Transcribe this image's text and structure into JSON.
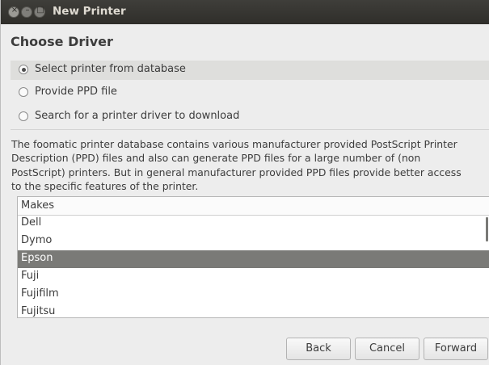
{
  "window": {
    "title": "New Printer",
    "controls": [
      "close-icon",
      "minimize-icon",
      "maximize-icon"
    ]
  },
  "page": {
    "heading": "Choose Driver"
  },
  "options": [
    {
      "label": "Select printer from database",
      "selected": true
    },
    {
      "label": "Provide PPD file",
      "selected": false
    },
    {
      "label": "Search for a printer driver to download",
      "selected": false
    }
  ],
  "description": {
    "lines": [
      "The foomatic printer database contains various manufacturer provided PostScript Printer",
      "Description (PPD) files and also can generate PPD files for a large number of (non",
      "PostScript) printers. But in general manufacturer provided PPD files provide better access",
      "to the specific features of the printer."
    ]
  },
  "makes": {
    "header": "Makes",
    "items": [
      "Dell",
      "Dymo",
      "Epson",
      "Fuji",
      "Fujifilm",
      "Fujitsu"
    ],
    "selected": "Epson"
  },
  "buttons": {
    "back": "Back",
    "cancel": "Cancel",
    "forward": "Forward"
  }
}
